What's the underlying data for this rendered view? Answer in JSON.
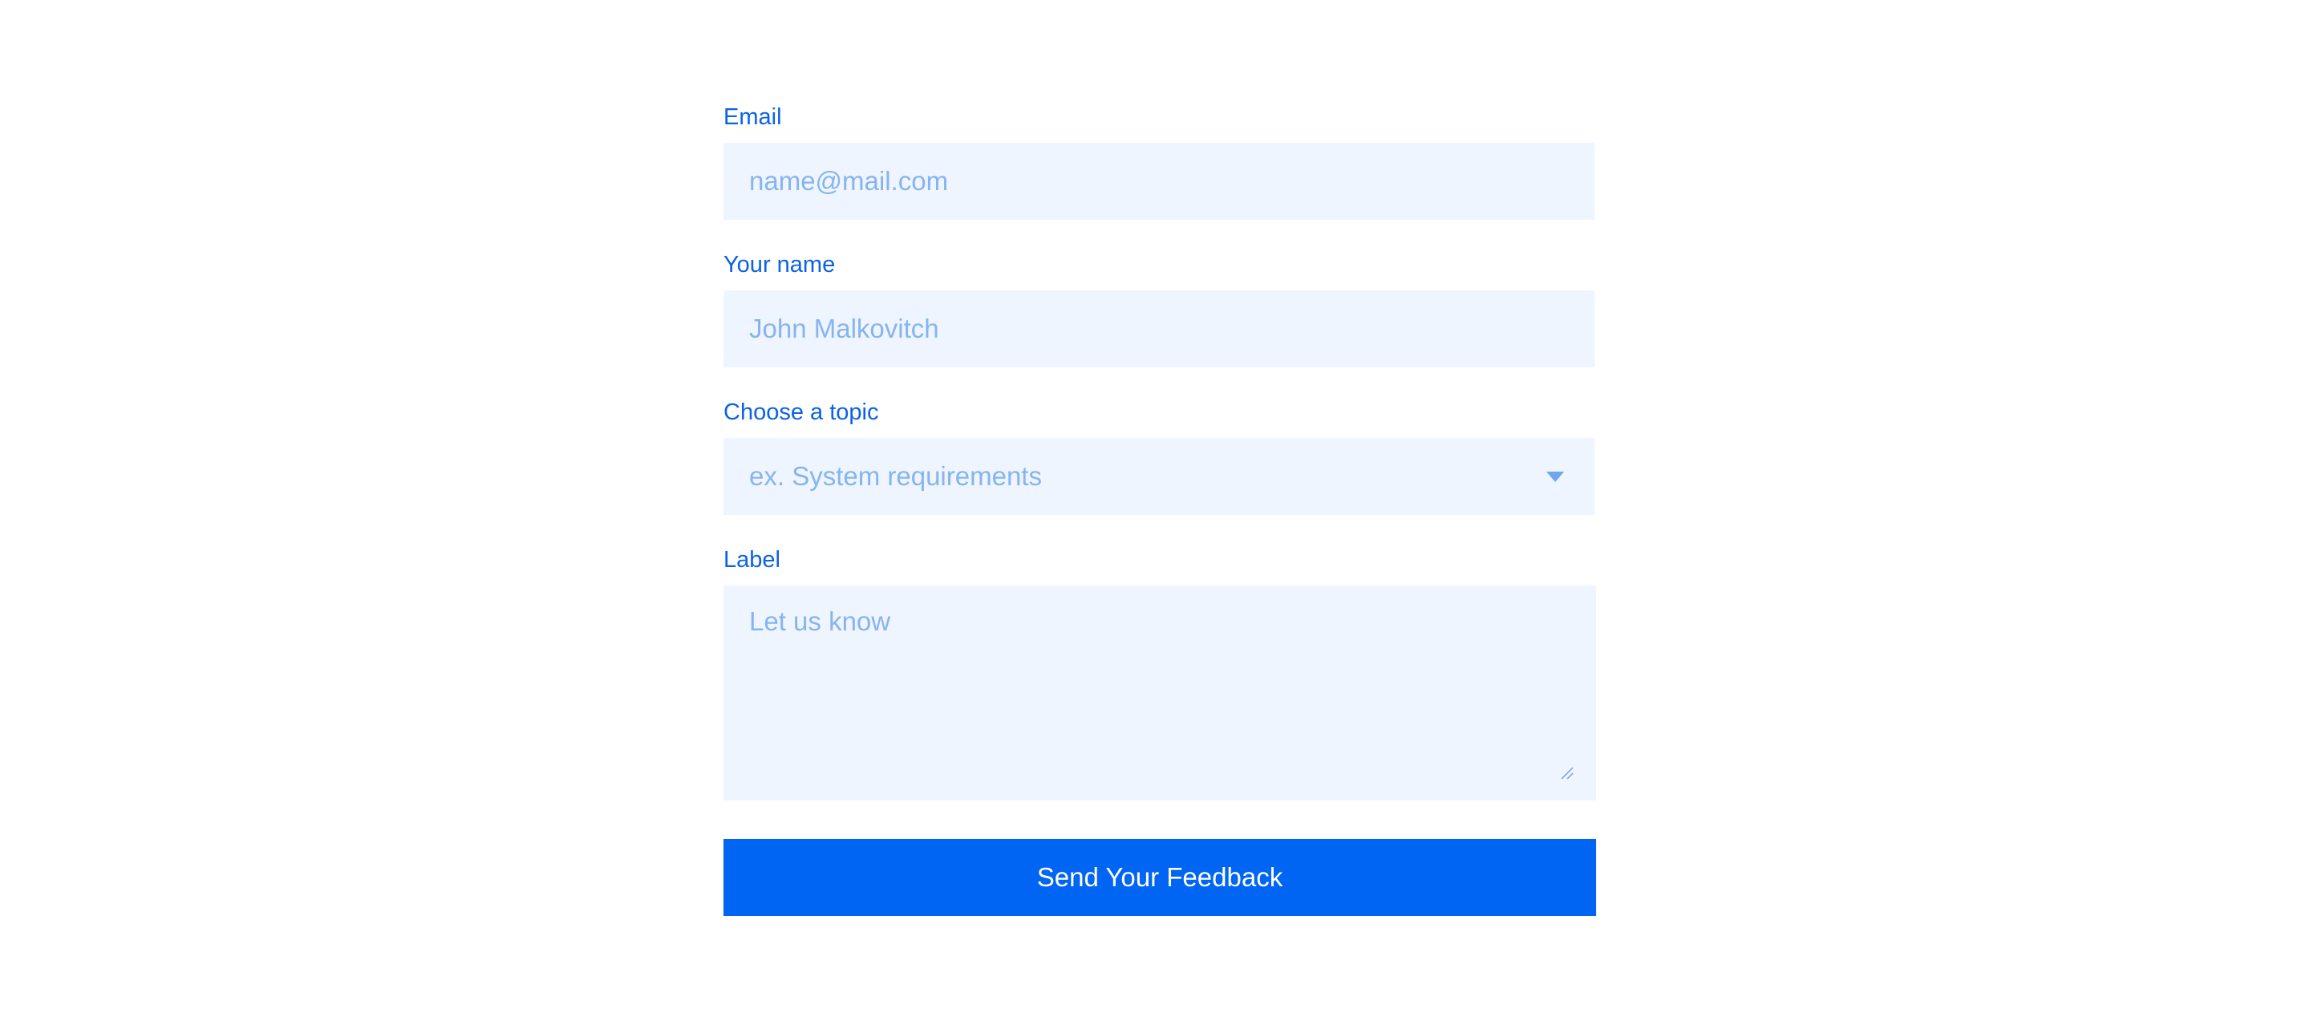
{
  "form": {
    "email": {
      "label": "Email",
      "placeholder": "name@mail.com",
      "value": ""
    },
    "name": {
      "label": "Your name",
      "placeholder": "John Malkovitch",
      "value": ""
    },
    "topic": {
      "label": "Choose a topic",
      "selected": "ex. System requirements",
      "icon": "chevron-down-icon"
    },
    "message": {
      "label": "Label",
      "placeholder": "Let us know",
      "value": "",
      "grip_icon": "resize-grip-icon"
    },
    "submit_label": "Send Your Feedback"
  },
  "colors": {
    "label": "#0a62e6",
    "field_bg": "#eff5fe",
    "placeholder": "#86b4f1",
    "button_bg": "#0065f2",
    "button_text": "#ffffff"
  }
}
